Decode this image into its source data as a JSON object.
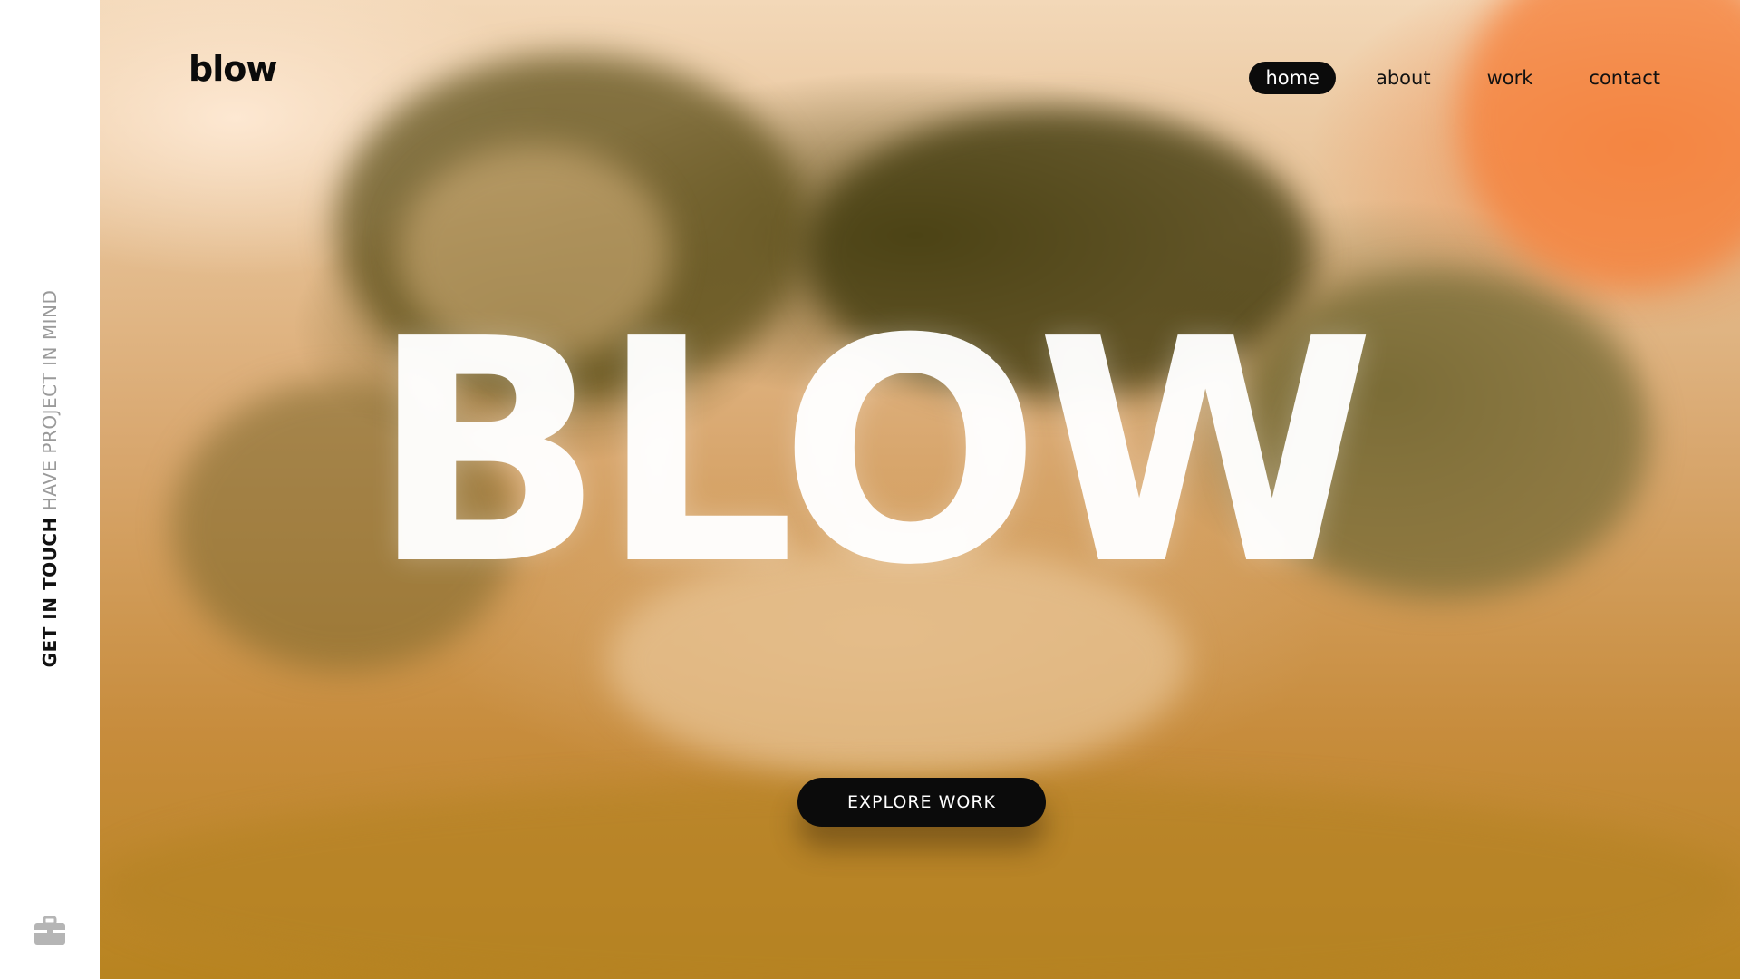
{
  "sidebar": {
    "cta_strong": "GET IN TOUCH",
    "cta_light": "HAVE PROJECT IN MIND",
    "icon": "briefcase-icon"
  },
  "header": {
    "logo": "blow",
    "nav": [
      {
        "label": "home",
        "active": true
      },
      {
        "label": "about",
        "active": false
      },
      {
        "label": "work",
        "active": false
      },
      {
        "label": "contact",
        "active": false
      }
    ]
  },
  "hero": {
    "headline": "BLOW",
    "cta_label": "EXPLORE WORK"
  },
  "colors": {
    "accent_dark": "#0b0b0b",
    "sidebar_bg": "#ffffff",
    "muted_text": "#9a9a9a",
    "hero_orange": "#f07832",
    "hero_olive": "#6e5f28"
  }
}
